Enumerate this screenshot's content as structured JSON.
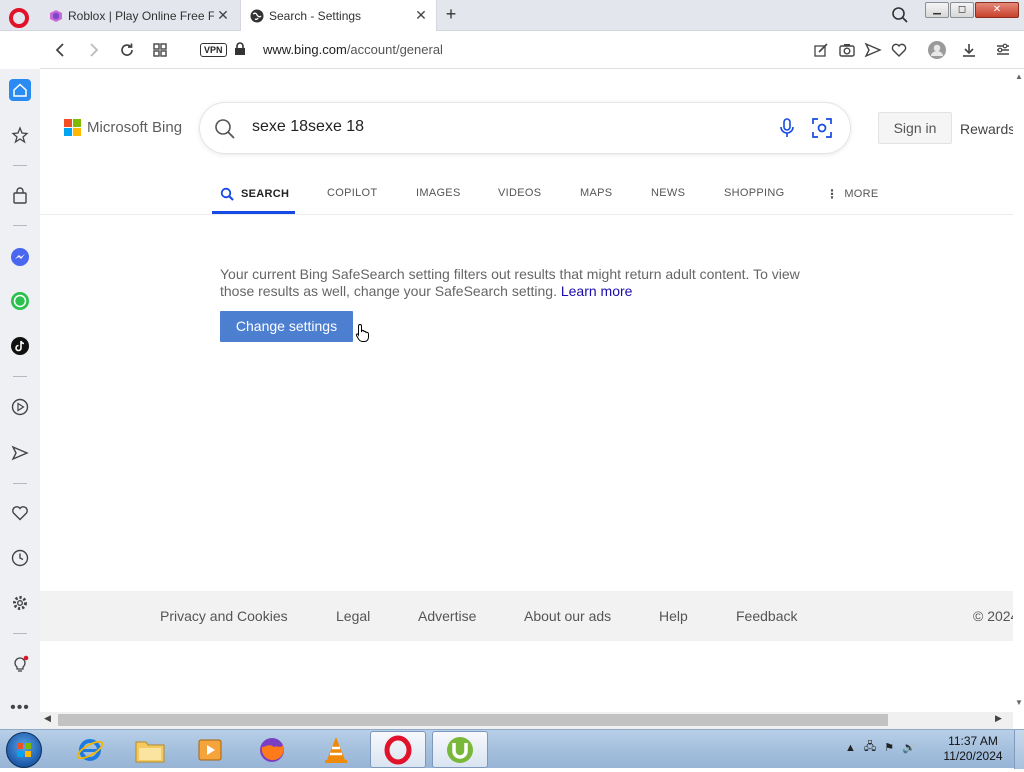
{
  "browser": {
    "tabs": [
      {
        "title": "Roblox | Play Online Free Fu",
        "active": false
      },
      {
        "title": "Search - Settings",
        "active": true
      }
    ],
    "address": {
      "vpn_label": "VPN",
      "url_host": "www.bing.com",
      "url_path": "/account/general"
    }
  },
  "page": {
    "logo_text": "Microsoft Bing",
    "search_query": "sexe 18sexe 18",
    "sign_in_label": "Sign in",
    "rewards_label": "Rewards",
    "scopes": [
      {
        "label": "SEARCH",
        "active": true
      },
      {
        "label": "COPILOT",
        "active": false
      },
      {
        "label": "IMAGES",
        "active": false
      },
      {
        "label": "VIDEOS",
        "active": false
      },
      {
        "label": "MAPS",
        "active": false
      },
      {
        "label": "NEWS",
        "active": false
      },
      {
        "label": "SHOPPING",
        "active": false
      },
      {
        "label": "MORE",
        "active": false
      }
    ],
    "notice_text": "Your current Bing SafeSearch setting filters out results that might return adult content. To view those results as well, change your SafeSearch setting.",
    "learn_more_label": "Learn more",
    "change_settings_label": "Change settings",
    "footer_links": [
      "Privacy and Cookies",
      "Legal",
      "Advertise",
      "About our ads",
      "Help",
      "Feedback",
      "© 2024"
    ]
  },
  "taskbar": {
    "clock_time": "11:37 AM",
    "clock_date": "11/20/2024"
  },
  "colors": {
    "accent_blue": "#174ae4",
    "button_blue": "#4c7fd0",
    "opera_red": "#e0132b"
  }
}
